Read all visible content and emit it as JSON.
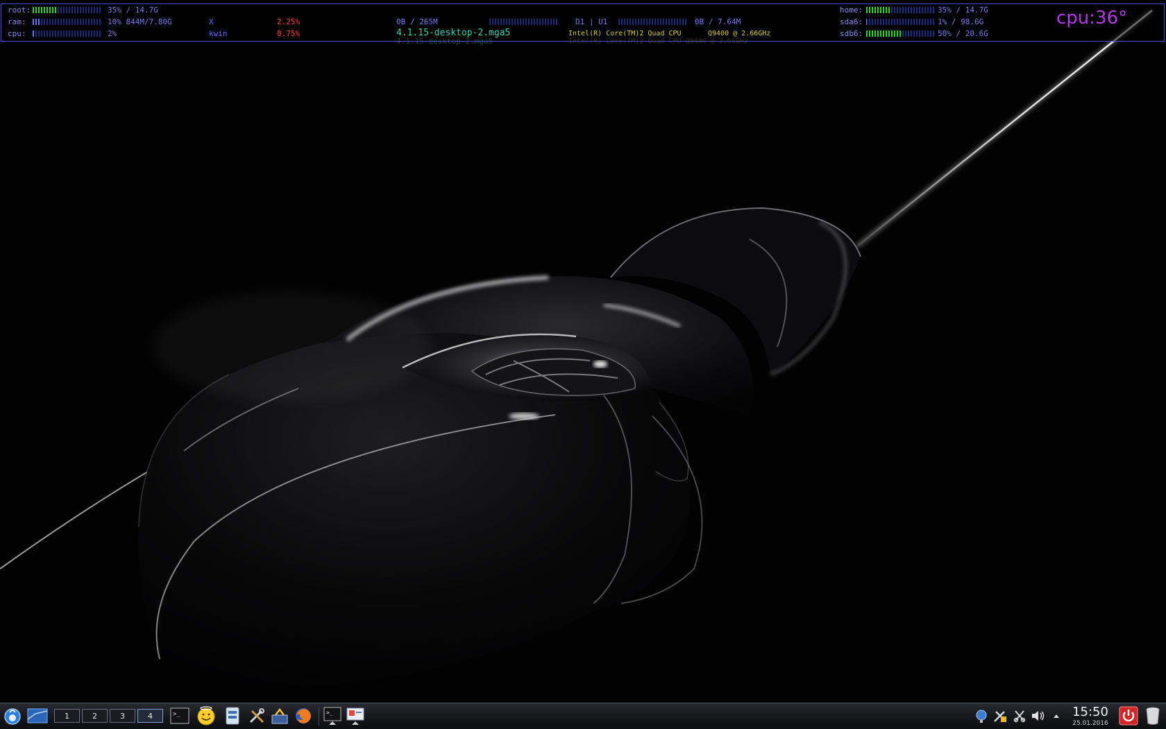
{
  "conky": {
    "root_label": "root:",
    "root_value": "35% / 14.7G",
    "root_fill": 0.35,
    "ram_label": "ram:",
    "ram_value": "10% 844M/7.80G",
    "ram_fill": 0.1,
    "cpu_label": "cpu:",
    "cpu_value": "2%",
    "cpu_fill": 0.02,
    "proc1_name": "X",
    "proc1_pct": "2.25%",
    "proc2_name": "kwin",
    "proc2_pct": "0.75%",
    "swap_value": "0B / 265M",
    "swap_fill": 0.0,
    "net_label": "D1 | U1",
    "net_value": "0B / 7.64M",
    "kernel": "4.1.15-desktop-2.mga5",
    "kernel_ghost": "4.1.15-desktop-2.mga5",
    "cpu_model": "Intel(R) Core(TM)2 Quad CPU",
    "cpu_freq": "Q9400  @ 2.66GHz",
    "cpu_ghost": "Intel(R) Core(TM)2 Quad CPU    Q9400  @ 2.66GHz",
    "home_label": "home:",
    "home_value": "35% / 14.7G",
    "home_fill": 0.35,
    "sda6_label": "sda6:",
    "sda6_value": "1% / 98.6G",
    "sda6_fill": 0.01,
    "sdb6_label": "sdb6:",
    "sdb6_value": "50% / 20.6G",
    "sdb6_fill": 0.5,
    "cpu_temp": "cpu:36°"
  },
  "colors": {
    "conky_border": "#4a4ad8",
    "temp": "#b23ae6",
    "process_pct": "#ff3b3b",
    "kernel": "#42c9b6",
    "cpu_info": "#d9c838",
    "bar_green": "#2fd12f",
    "bar_blue": "#6a72ff"
  },
  "taskbar": {
    "launcher_icon": "kickoff-menu-icon",
    "show_desktop_icon": "desktop-icon",
    "desktops": [
      {
        "label": "1",
        "active": false
      },
      {
        "label": "2",
        "active": false
      },
      {
        "label": "3",
        "active": false
      },
      {
        "label": "4",
        "active": true
      }
    ],
    "quick_launch": [
      "terminal-icon",
      "smiley-icon",
      "file-manager-icon",
      "tools-icon",
      "software-install-icon",
      "firefox-icon"
    ],
    "tasks": [
      "terminal-task-icon",
      "presentation-task-icon"
    ],
    "tray": [
      "network-icon",
      "kde-connect-icon",
      "clipboard-icon",
      "volume-icon",
      "tray-expand-icon"
    ],
    "clock_time": "15:50",
    "clock_date": "25.01.2016",
    "logout_icon": "power-icon",
    "trash_icon": "trash-icon"
  }
}
